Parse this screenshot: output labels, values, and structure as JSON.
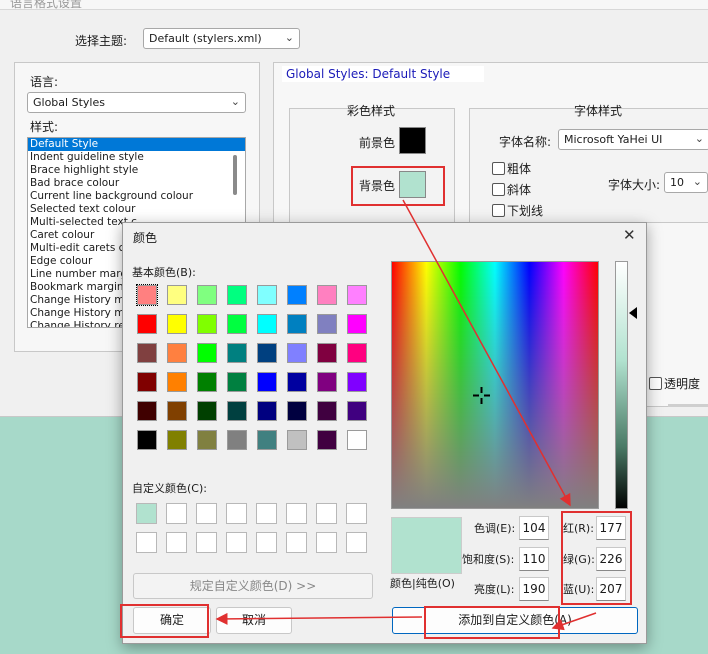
{
  "bg_window": {
    "title": "语言格式设置",
    "theme_label": "选择主题:",
    "theme_value": "Default (stylers.xml)",
    "language_label": "语言:",
    "language_value": "Global Styles",
    "style_label": "样式:",
    "styles": [
      "Default Style",
      "Indent guideline style",
      "Brace highlight style",
      "Bad brace colour",
      "Current line background colour",
      "Selected text colour",
      "Multi-selected text c",
      "Caret colour",
      "Multi-edit carets colo",
      "Edge colour",
      "Line number margin",
      "Bookmark margin",
      "Change History mar",
      "Change History mod",
      "Change History revi"
    ],
    "panel_title": "Global Styles: Default Style",
    "color_style_title": "彩色样式",
    "foreground_label": "前景色",
    "background_label": "背景色",
    "foreground_color": "#000000",
    "background_color": "#b1e2cf",
    "font_style_title": "字体样式",
    "font_name_label": "字体名称:",
    "font_name_value": "Microsoft YaHei UI",
    "bold_label": "粗体",
    "italic_label": "斜体",
    "underline_label": "下划线",
    "font_size_label": "字体大小:",
    "font_size_value": "10",
    "transparency_label": "透明度"
  },
  "dialog": {
    "title": "颜色",
    "basic_colors_label": "基本颜色(B):",
    "basic_colors": [
      [
        "#ff8080",
        "#ffff80",
        "#80ff80",
        "#00ff80",
        "#80ffff",
        "#0080ff",
        "#ff80c0",
        "#ff80ff"
      ],
      [
        "#ff0000",
        "#ffff00",
        "#80ff00",
        "#00ff40",
        "#00ffff",
        "#0080c0",
        "#8080c0",
        "#ff00ff"
      ],
      [
        "#804040",
        "#ff8040",
        "#00ff00",
        "#008080",
        "#004080",
        "#8080ff",
        "#800040",
        "#ff0080"
      ],
      [
        "#800000",
        "#ff8000",
        "#008000",
        "#008040",
        "#0000ff",
        "#0000a0",
        "#800080",
        "#8000ff"
      ],
      [
        "#400000",
        "#804000",
        "#004000",
        "#004040",
        "#000080",
        "#000040",
        "#400040",
        "#400080"
      ],
      [
        "#000000",
        "#808000",
        "#808040",
        "#808080",
        "#408080",
        "#c0c0c0",
        "#400040",
        "#ffffff"
      ]
    ],
    "custom_colors_label": "自定义颜色(C):",
    "custom_colors": [
      "#b1e2cf",
      "#ffffff",
      "#ffffff",
      "#ffffff",
      "#ffffff",
      "#ffffff",
      "#ffffff",
      "#ffffff",
      "#ffffff",
      "#ffffff",
      "#ffffff",
      "#ffffff",
      "#ffffff",
      "#ffffff",
      "#ffffff",
      "#ffffff"
    ],
    "define_custom_button": "规定自定义颜色(D) >>",
    "ok_button": "确定",
    "cancel_button": "取消",
    "preview_color": "#b1e2cf",
    "color_solid_label": "颜色|纯色(O)",
    "hue_label": "色调(E):",
    "hue_value": "104",
    "sat_label": "饱和度(S):",
    "sat_value": "110",
    "lum_label": "亮度(L):",
    "lum_value": "190",
    "red_label": "红(R):",
    "red_value": "177",
    "green_label": "绿(G):",
    "green_value": "226",
    "blue_label": "蓝(U):",
    "blue_value": "207",
    "add_custom_button": "添加到自定义颜色(A)"
  }
}
